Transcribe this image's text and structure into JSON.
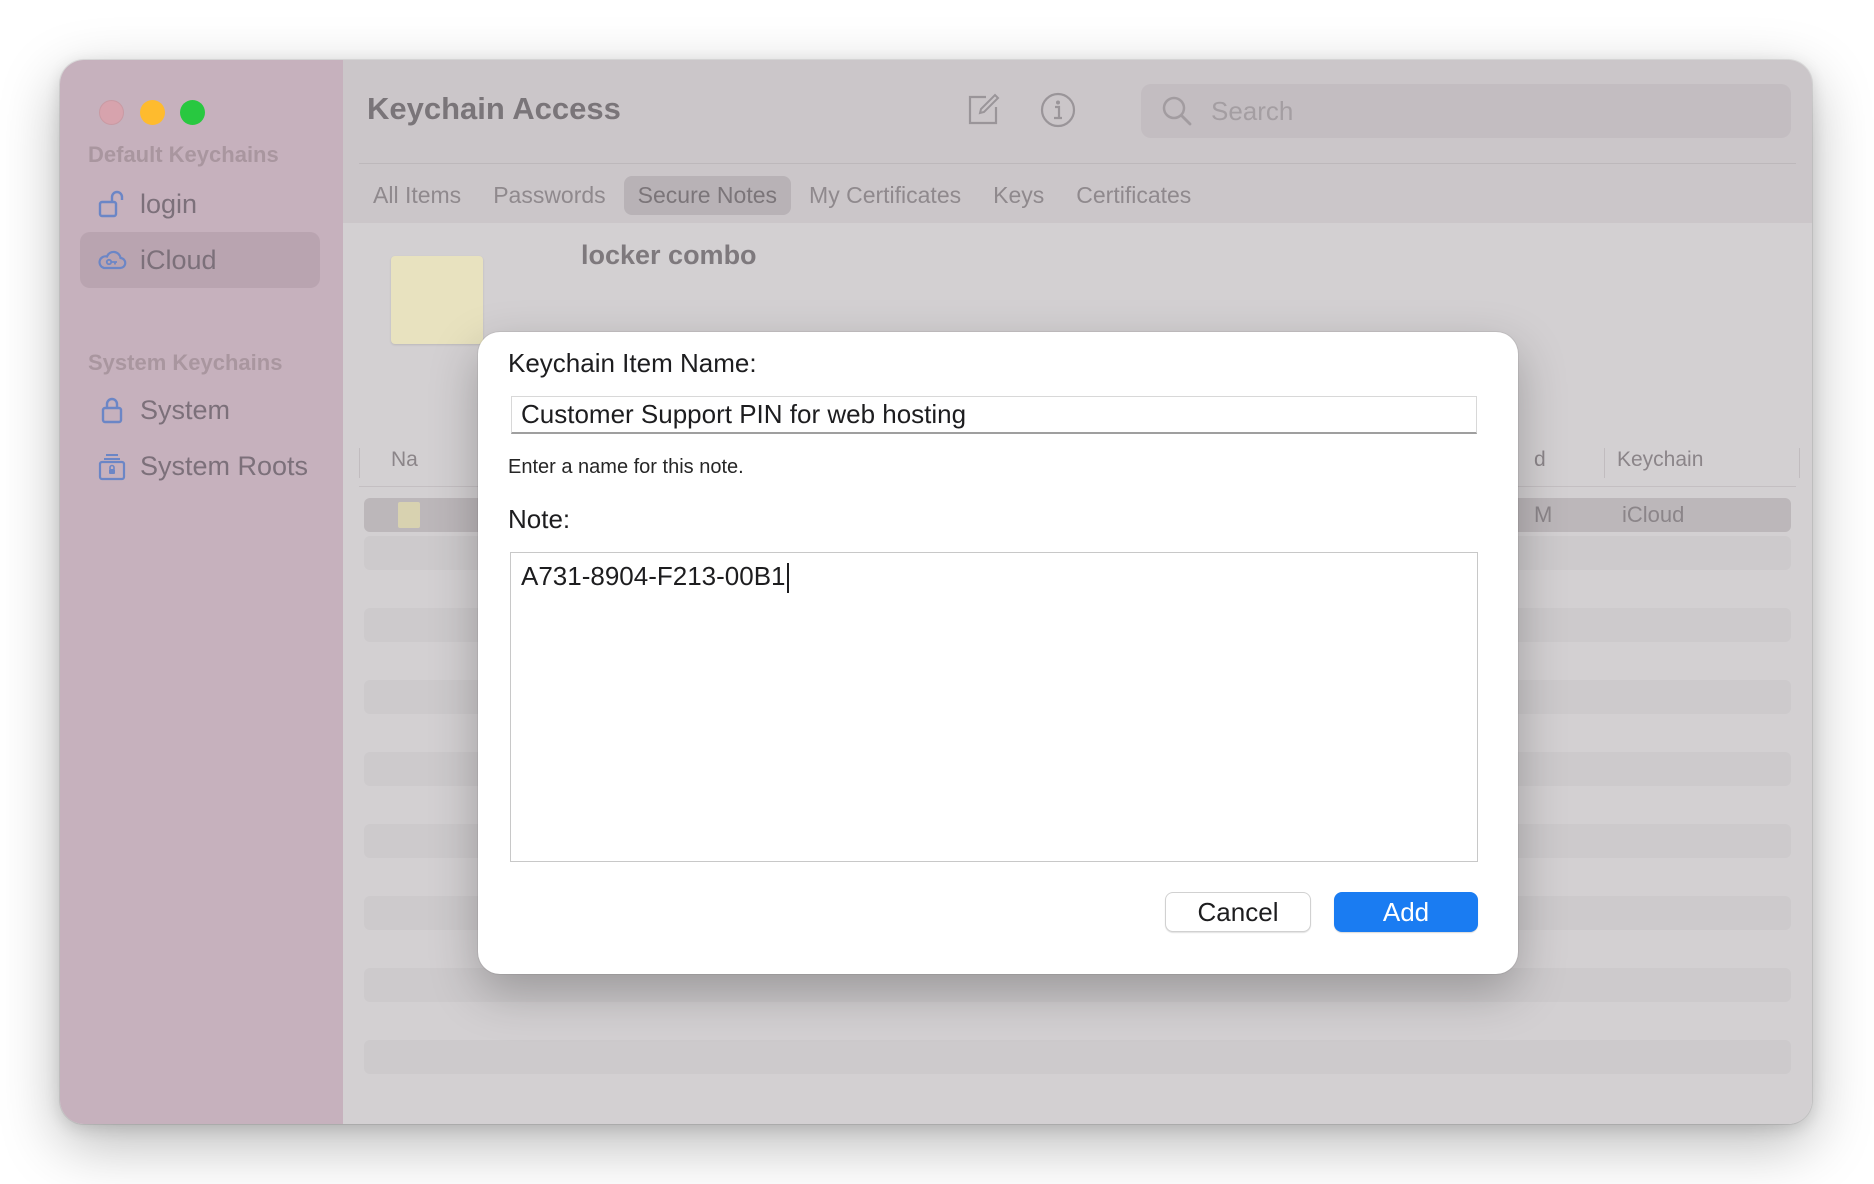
{
  "app": {
    "title": "Keychain Access",
    "compose_icon": "compose-icon",
    "info_icon": "info-icon"
  },
  "search": {
    "placeholder": "Search",
    "icon": "search-icon"
  },
  "sidebar": {
    "sections": [
      {
        "title": "Default Keychains",
        "items": [
          {
            "label": "login",
            "icon": "unlocked-padlock-icon",
            "selected": false
          },
          {
            "label": "iCloud",
            "icon": "icloud-icon",
            "selected": true
          }
        ]
      },
      {
        "title": "System Keychains",
        "items": [
          {
            "label": "System",
            "icon": "padlock-icon",
            "selected": false
          },
          {
            "label": "System Roots",
            "icon": "cabinet-lock-icon",
            "selected": false
          }
        ]
      }
    ]
  },
  "tabs": [
    {
      "label": "All Items",
      "active": false
    },
    {
      "label": "Passwords",
      "active": false
    },
    {
      "label": "Secure Notes",
      "active": true
    },
    {
      "label": "My Certificates",
      "active": false
    },
    {
      "label": "Keys",
      "active": false
    },
    {
      "label": "Certificates",
      "active": false
    }
  ],
  "preview": {
    "title": "locker combo"
  },
  "table": {
    "columns": {
      "name": "Na",
      "date": "d",
      "keychain": "Keychain"
    },
    "rows": [
      {
        "date": "M",
        "keychain": "iCloud",
        "selected": true
      }
    ]
  },
  "dialog": {
    "name_label": "Keychain Item Name:",
    "name_value": "Customer Support PIN for web hosting",
    "name_hint": "Enter a name for this note.",
    "note_label": "Note:",
    "note_value": "A731-8904-F213-00B1",
    "cancel_label": "Cancel",
    "add_label": "Add"
  },
  "colors": {
    "accent": "#1a7cf2",
    "close": "#d7a3ad",
    "minimize": "#febb2e",
    "maximize": "#28c840",
    "sidebar": "#c6b1bd"
  }
}
